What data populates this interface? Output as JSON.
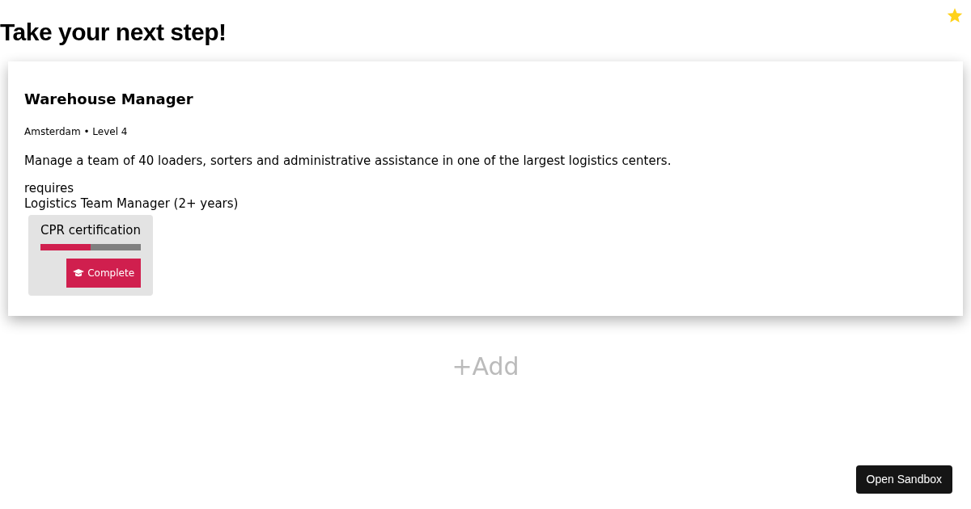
{
  "title": "Take your next step!",
  "job": {
    "title": "Warehouse Manager",
    "meta": "Amsterdam • Level 4",
    "description": "Manage a team of 40 loaders, sorters and administrative assistance in one of the largest logistics centers.",
    "requires_label": "requires",
    "requirement": "Logistics Team Manager (2+ years)",
    "skills": [
      {
        "name": "CPR certification",
        "level": 0.5,
        "button": "Complete"
      }
    ]
  },
  "add_button": "+Add",
  "sandbox_button": "Open Sandbox"
}
